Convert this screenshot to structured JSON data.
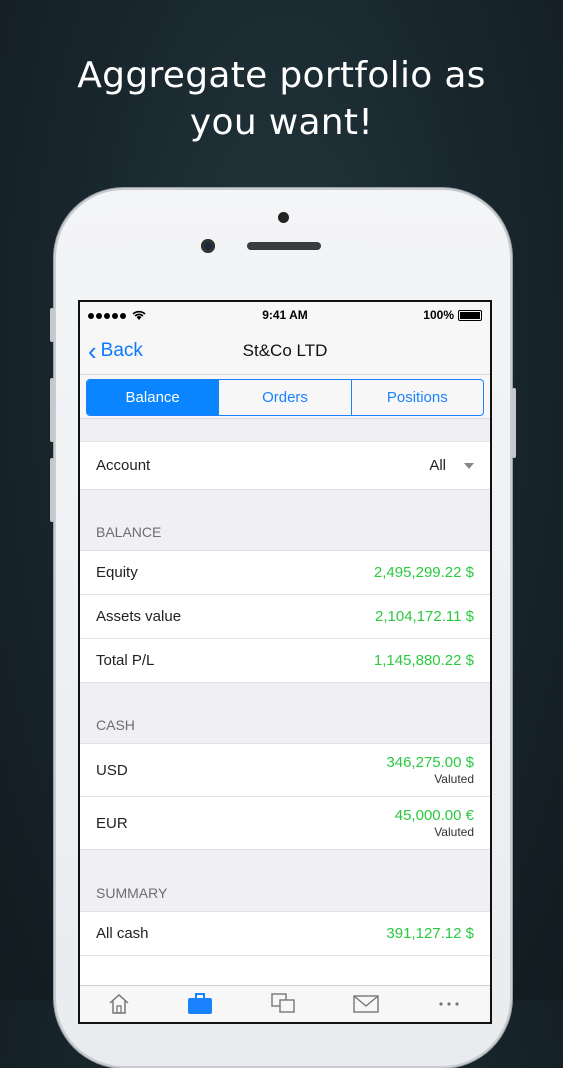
{
  "headline": {
    "line1": "Aggregate portfolio as",
    "line2": "you want!"
  },
  "statusbar": {
    "time": "9:41 AM",
    "battery": "100%"
  },
  "navbar": {
    "back_label": "Back",
    "title": "St&Co LTD"
  },
  "tabs": [
    {
      "label": "Balance",
      "active": true
    },
    {
      "label": "Orders",
      "active": false
    },
    {
      "label": "Positions",
      "active": false
    }
  ],
  "account": {
    "label": "Account",
    "value": "All"
  },
  "balance": {
    "header": "BALANCE",
    "rows": [
      {
        "label": "Equity",
        "value": "2,495,299.22 $"
      },
      {
        "label": "Assets value",
        "value": "2,104,172.11 $"
      },
      {
        "label": "Total P/L",
        "value": "1,145,880.22 $"
      }
    ]
  },
  "cash": {
    "header": "CASH",
    "rows": [
      {
        "label": "USD",
        "value": "346,275.00 $",
        "note": "Valuted"
      },
      {
        "label": "EUR",
        "value": "45,000.00 €",
        "note": "Valuted"
      }
    ]
  },
  "summary": {
    "header": "SUMMARY",
    "rows": [
      {
        "label": "All cash",
        "value": "391,127.12 $"
      }
    ]
  },
  "tabbar": {
    "icons": [
      "home-icon",
      "briefcase-icon",
      "copy-icon",
      "mail-icon",
      "more-icon"
    ]
  },
  "colors": {
    "accent": "#0a84ff",
    "positive": "#2ac940",
    "background": "#18262c"
  }
}
